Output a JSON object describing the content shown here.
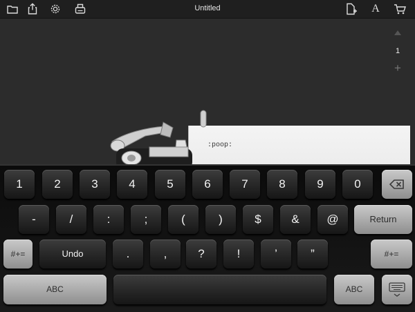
{
  "window": {
    "title": "Untitled"
  },
  "toolbar": {
    "left_icons": [
      "folder-icon",
      "share-icon",
      "settings-gear-icon",
      "print-icon"
    ],
    "right_icons": [
      "new-document-icon",
      "font-icon",
      "cart-icon"
    ],
    "font_label": "A"
  },
  "pager": {
    "current_page": "1",
    "add_label": "+"
  },
  "document": {
    "text": ":poop:"
  },
  "keyboard": {
    "row1": [
      "1",
      "2",
      "3",
      "4",
      "5",
      "6",
      "7",
      "8",
      "9",
      "0"
    ],
    "row2": [
      "-",
      "/",
      ":",
      ";",
      "(",
      ")",
      "$",
      "&",
      "@"
    ],
    "row3": [
      ".",
      ",",
      "?",
      "!",
      "’",
      "”"
    ],
    "return_label": "Return",
    "symbols_label": "#+=",
    "undo_label": "Undo",
    "abc_label": "ABC",
    "accent_color": "#a8a8a8"
  }
}
